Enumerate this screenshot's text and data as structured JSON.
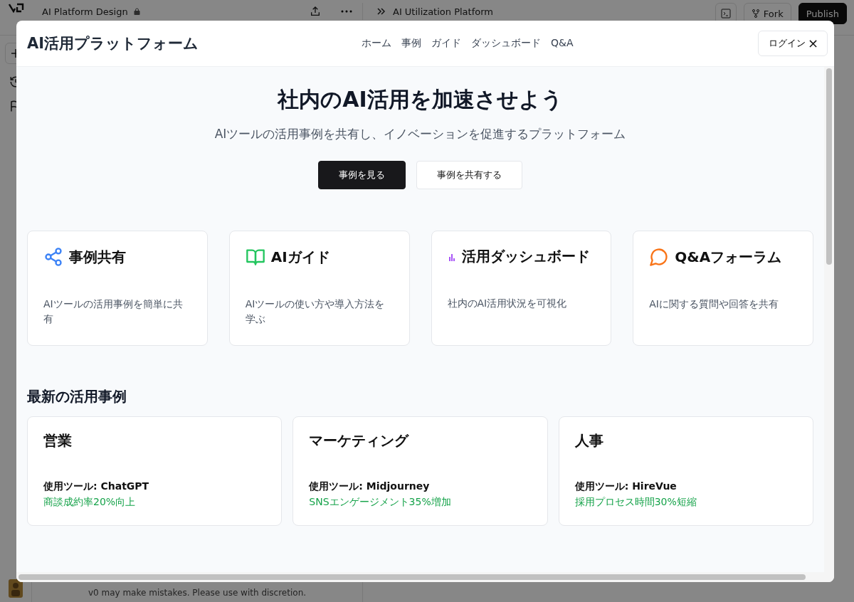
{
  "editor": {
    "project_title": "AI Platform Design",
    "preview_title": "AI Utilization Platform",
    "actions": [
      {
        "label": "Fork",
        "kind": "secondary"
      },
      {
        "label": "Publish",
        "kind": "primary"
      }
    ],
    "footer_note": "v0 may make mistakes. Please use with discretion."
  },
  "modal": {
    "site_title": "AI活用プラットフォーム",
    "nav": [
      "ホーム",
      "事例",
      "ガイド",
      "ダッシュボード",
      "Q&A"
    ],
    "login": "ログイン",
    "close": "×",
    "hero": {
      "title": "社内のAI活用を加速させよう",
      "subtitle": "AIツールの活用事例を共有し、イノベーションを促進するプラットフォーム",
      "buttons": [
        {
          "label": "事例を見る",
          "kind": "primary"
        },
        {
          "label": "事例を共有する",
          "kind": "secondary"
        }
      ]
    },
    "features": [
      {
        "kind": "share",
        "color": "#3b82f6",
        "title": "事例共有",
        "text": "AIツールの活用事例を簡単に共有"
      },
      {
        "kind": "book",
        "color": "#22c55e",
        "title": "AIガイド",
        "text": "AIツールの使い方や導入方法を学ぶ"
      },
      {
        "kind": "chart",
        "color": "#a855f7",
        "title": "活用ダッシュボード",
        "text": "社内のAI活用状況を可視化"
      },
      {
        "kind": "chat",
        "color": "#f97316",
        "title": "Q&Aフォーラム",
        "text": "AIに関する質問や回答を共有"
      }
    ],
    "cases_title": "最新の活用事例",
    "cases": [
      {
        "department": "営業",
        "tool": "使用ツール: ChatGPT",
        "result": "商談成約率20%向上"
      },
      {
        "department": "マーケティング",
        "tool": "使用ツール: Midjourney",
        "result": "SNSエンゲージメント35%増加"
      },
      {
        "department": "人事",
        "tool": "使用ツール: HireVue",
        "result": "採用プロセス時間30%短縮"
      }
    ]
  }
}
